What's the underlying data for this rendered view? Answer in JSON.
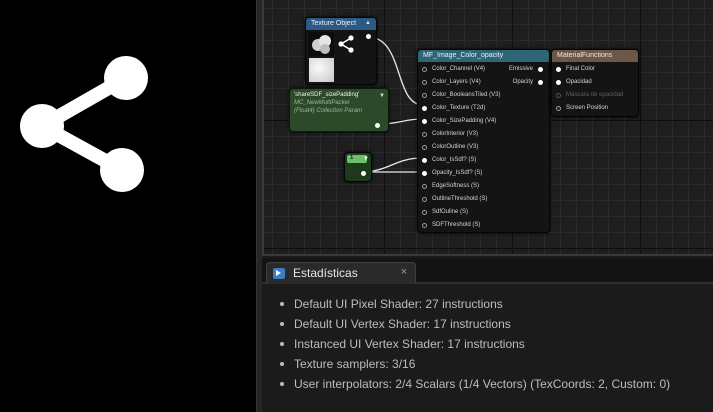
{
  "preview": {
    "icon": "share-icon"
  },
  "graph": {
    "texture_node": {
      "title": "Texture Object",
      "icon": "share-icon"
    },
    "param_node": {
      "line1": "'shareSDF_sizePadding'",
      "line2": "MC_NewMultiPacker",
      "line3": "(Float4) Collection Param"
    },
    "constant_node": {
      "value": "1"
    },
    "function_node": {
      "title": "MF_Image_Color_opacity",
      "inputs": [
        "Color_Channel (V4)",
        "Color_Layers (V4)",
        "Color_BooleansTiled (V3)",
        "Color_Texture (T2d)",
        "Color_SizePadding (V4)",
        "ColorInterior (V3)",
        "ColorOutline (V3)",
        "Color_IsSdf? (S)",
        "Opacity_IsSdf? (S)",
        "EdgeSoftness (S)",
        "OutlineThreshold (S)",
        "SdfOuline (S)",
        "SDFThreshold (S)"
      ],
      "outputs": [
        "Emissive",
        "Opacity"
      ]
    },
    "result_node": {
      "title": "MaterialFunctions",
      "inputs": [
        "Final Color",
        "Opacidad",
        "Máscara de opacidad",
        "Screen Position"
      ]
    }
  },
  "stats": {
    "tab_label": "Estadísticas",
    "close_glyph": "×",
    "lines": [
      "Default UI Pixel Shader: 27 instructions",
      "Default UI Vertex Shader: 17 instructions",
      "Instanced UI Vertex Shader: 17 instructions",
      "Texture samplers: 3/16",
      "User interpolators: 2/4 Scalars (1/4 Vectors) (TexCoords: 2, Custom: 0)"
    ]
  }
}
